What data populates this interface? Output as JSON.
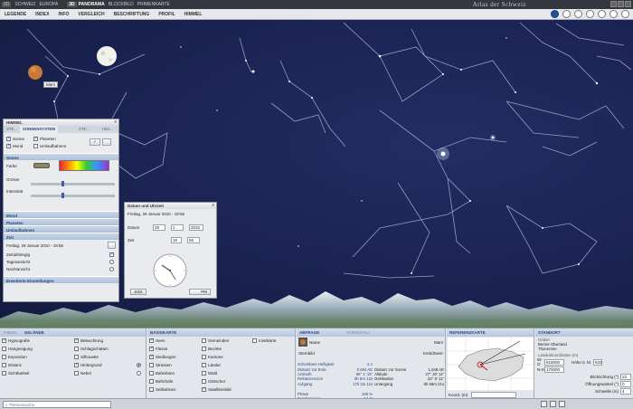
{
  "topbar": {
    "items": [
      "2D",
      "SCHWEIZ",
      "EUROPA",
      "3D",
      "PANORAMA",
      "BLOCKBILD",
      "PRIMENKARTE"
    ],
    "atlas": "Atlas der Schweiz"
  },
  "menu": [
    "LEGENDE",
    "INDEX",
    "INFO",
    "VERGLEICH",
    "BESCHRIFTUNG",
    "PROFIL",
    "HIMMEL"
  ],
  "sky": {
    "mars_label": "Mars"
  },
  "himmel": {
    "title": "HIMMEL",
    "tabs": [
      "STE...",
      "SONNENSYSTEM",
      "STE...",
      "HIM..."
    ],
    "opts": {
      "sonne": "Sonne",
      "mond": "Mond",
      "planeten": "Planeten",
      "umlauf": "Umlaufbahnen"
    },
    "sec_sonne": "Sonne",
    "farbe": "Farbe",
    "grosse": "Grösse",
    "intensitat": "Intensität",
    "sec_mond": "Mond",
    "sec_planeten": "Planeten",
    "sec_umlauf": "Umlaufbahnen",
    "sec_zeit": "Zeit",
    "datetime": "Freitag, 29 Januar 2010 - 19:56",
    "zeitabhangig": "Zeitabhängig",
    "tagesansicht": "Tagesansicht",
    "nachtansicht": "Nachtansicht",
    "sec_erweitert": "Erweiterte Einstellungen"
  },
  "dt": {
    "title": "Datum und Uhrzeit",
    "line": "Freitag, 29 Januar 2010 - 19:56",
    "datum_label": "Datum",
    "day": "29",
    "month": "1",
    "year": "2010",
    "zeit_label": "Zeit",
    "hour": "19",
    "minute": "56",
    "jetzt": "Jetzt",
    "ampm": "PM"
  },
  "bottom": {
    "thema": {
      "tabs": [
        "THEMA",
        "GELÄNDE"
      ],
      "items": [
        "Hypsografie",
        "Hangneigung",
        "Exposition",
        "Distanz",
        "Sichtbarkeit"
      ],
      "items2": [
        "Beleuchtung",
        "Schlagschatten",
        "Silhouette",
        "Hintergrund",
        "Nebel"
      ]
    },
    "basis": {
      "title": "BASISKARTE",
      "col1": [
        "Seen",
        "Flüsse",
        "Siedlungen",
        "Strassen",
        "Bahnlinien",
        "Bahnhöfe",
        "Seilbahnen"
      ],
      "col2": [
        "Gemeinden",
        "Bezirke",
        "Kantone",
        "Länder",
        "Wald",
        "Gletscher",
        "Satellitenbild"
      ],
      "col3": [
        "Inselkarte"
      ]
    },
    "abfrage": {
      "tabs": [
        "ABFRAGE",
        "VORSCHAU"
      ],
      "name_label": "Name",
      "name_value": "Mars",
      "stern": "Sternbild",
      "stern_val": "Kreb/Zwerr",
      "rows": [
        [
          "Scheinbare Helligkeit",
          "-1.1",
          "",
          ""
        ],
        [
          "Distanz zur Erde",
          "0.664 AE",
          "Distanz zur Sonne",
          "1.648 AE"
        ],
        [
          "Azimuth",
          "86° 1' 15\"",
          "Altitude",
          "27° 20' 11\""
        ],
        [
          "Rektaszension",
          "8h 5m 12s",
          "Deklination",
          "22° 6' 11\""
        ],
        [
          "Aufgang",
          "17h 2m 11s",
          "Untergang",
          "8h 56m 21s"
        ],
        [
          "",
          ""
        ],
        [
          "Phase",
          "100 %",
          "",
          ""
        ],
        [
          "Durchmesser",
          "14.1\"",
          "",
          ""
        ]
      ]
    },
    "ref": {
      "title": "REFERENZKARTE",
      "koord": "Koord. (m)"
    },
    "standort": {
      "title": "STANDORT",
      "ort_label": "Gebiet",
      "ort1": "Berner Oberland",
      "ort2": "Thunersee",
      "landes": "Landeskoordinaten (m)",
      "wo_label": "W-O",
      "wo_val": "619000",
      "ns_label": "N-S",
      "ns_val": "170000",
      "hohe_label": "Höhe ü. M.",
      "hohe_val": "620",
      "blick_label": "Blickrichtung (°)",
      "blick_val": "22",
      "offnung_label": "Öffnungswinkel (°)",
      "offnung_val": "0",
      "schwelle_label": "Schwelle (m)",
      "schwelle_val": "4"
    }
  },
  "status": {
    "search_placeholder": "Themensuche"
  }
}
